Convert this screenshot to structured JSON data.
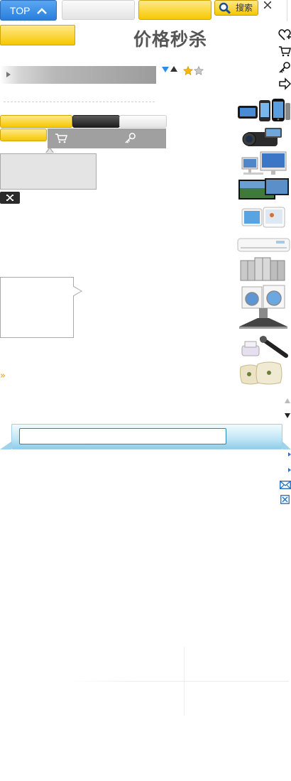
{
  "topbar": {
    "top_label": "TOP",
    "search_label": "搜索"
  },
  "headline": {
    "title": "价格秒杀"
  },
  "icons": {
    "top_chevron": "chevron-up-icon",
    "search": "magnifier-icon",
    "close": "close-icon",
    "side": [
      "heart-plus-icon",
      "cart-icon",
      "key-icon",
      "share-arrow-icon"
    ],
    "panel": [
      "cart-icon",
      "key-icon"
    ],
    "sort_down": "triangle-down-icon",
    "sort_up": "triangle-up-icon",
    "stars": [
      "star-gold-icon",
      "star-grey-icon"
    ],
    "scroll": [
      "scroll-up-icon",
      "scroll-down-icon"
    ],
    "mail": "mail-icon",
    "close_box": "close-box-icon",
    "double_chevron": "»"
  },
  "products": [
    {
      "name": "phones-thumbnail"
    },
    {
      "name": "camcorder-thumbnail"
    },
    {
      "name": "computers-thumbnail"
    },
    {
      "name": "television-thumbnail"
    },
    {
      "name": "tablets-thumbnail"
    },
    {
      "name": "air-conditioner-thumbnail"
    },
    {
      "name": "refrigerators-thumbnail"
    },
    {
      "name": "washing-machines-thumbnail"
    },
    {
      "name": "range-hood-thumbnail"
    },
    {
      "name": "small-appliances-thumbnail"
    },
    {
      "name": "pillows-thumbnail"
    }
  ],
  "colors": {
    "top_blue": "#2a7fdc",
    "accent_yellow": "#f6c700",
    "panel_grey": "#a0a0a0",
    "strip_blue": "#8fcde9",
    "input_border": "#2a84b8"
  }
}
